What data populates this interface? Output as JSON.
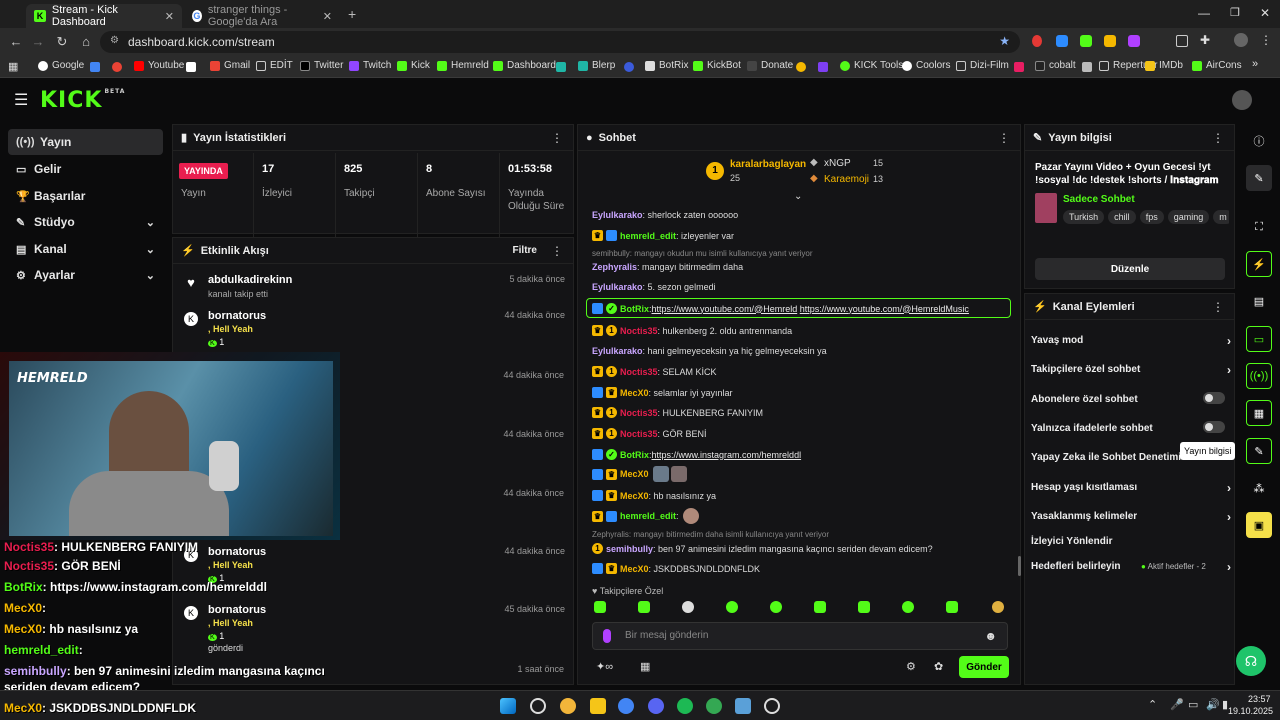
{
  "browser": {
    "tabs": [
      {
        "title": "Stream - Kick Dashboard",
        "active": true
      },
      {
        "title": "stranger things - Google'da Ara",
        "active": false
      }
    ],
    "url": "dashboard.kick.com/stream",
    "bookmarks": [
      "Google",
      "Youtube",
      "Gmail",
      "EDİT",
      "Twitter",
      "Twitch",
      "Kick",
      "Hemreld",
      "Dashboard",
      "Blerp",
      "BotRix",
      "KickBot",
      "Donate",
      "KICK Tools",
      "Coolors",
      "Dizi-Film",
      "cobalt",
      "Repertuar",
      "IMDb",
      "AirCons"
    ]
  },
  "kick": {
    "logo": "KICK",
    "logo_badge": "BETA"
  },
  "leftnav": {
    "items": [
      {
        "label": "Yayın",
        "icon": "broadcast-icon"
      },
      {
        "label": "Gelir",
        "icon": "money-icon"
      },
      {
        "label": "Başarılar",
        "icon": "trophy-icon"
      },
      {
        "label": "Stüdyo",
        "icon": "studio-icon"
      },
      {
        "label": "Kanal",
        "icon": "channel-icon"
      },
      {
        "label": "Ayarlar",
        "icon": "settings-icon"
      }
    ]
  },
  "stats": {
    "title": "Yayın İstatistikleri",
    "live_badge": "YAYINDA",
    "live_label": "Yayın",
    "viewers": "17",
    "viewers_label": "İzleyici",
    "followers": "825",
    "followers_label": "Takipçi",
    "subs": "8",
    "subs_label": "Abone Sayısı",
    "duration": "01:53:58",
    "duration_label": "Yayında Olduğu Süre"
  },
  "feed": {
    "title": "Etkinlik Akışı",
    "filter": "Filtre",
    "items": [
      {
        "name": "abdulkadirekinn",
        "sub": "kanalı takip etti",
        "time": "5 dakika önce"
      },
      {
        "name": "bornatorus",
        "sub": ", Hell Yeah",
        "count": "1",
        "time": "44 dakika önce"
      },
      {
        "time": "44 dakika önce"
      },
      {
        "time": "44 dakika önce"
      },
      {
        "time": "44 dakika önce"
      },
      {
        "name": "bornatorus",
        "sub": ", Hell Yeah",
        "count": "1",
        "time": "44 dakika önce"
      },
      {
        "name": "bornatorus",
        "sub": ", Hell Yeah",
        "count": "1",
        "extra": "gönderdi",
        "time": "45 dakika önce"
      },
      {
        "time": "1 saat önce"
      }
    ]
  },
  "chat": {
    "title": "Sohbet",
    "top1_name": "karalarbaglayan",
    "top1_count": "25",
    "top2_name": "xNGP",
    "top2_count": "15",
    "top3_name": "Karaemoji",
    "top3_count": "13",
    "lines": [
      {
        "user": "Eylulkarako",
        "msg": ": sherlock zaten oooooo"
      },
      {
        "user": "hemreld_edit",
        "msg": ": izleyenler var"
      },
      {
        "reply": "semihbully: mangayı okudun mu isimli kullanıcıya yanıt veriyor"
      },
      {
        "user": "Zephyralis",
        "msg": ": mangayı bitirmedim daha"
      },
      {
        "user": "Eylulkarako",
        "msg": ": 5. sezon gelmedi"
      },
      {
        "user": "BotRix",
        "msg": ": ",
        "link1": "https://www.youtube.com/@Hemreld",
        "link2": "https://www.youtube.com/@HemreldMusic"
      },
      {
        "user": "Noctis35",
        "msg": ": hulkenberg 2. oldu antrenmanda"
      },
      {
        "user": "Eylulkarako",
        "msg": ": hani gelmeyeceksin ya hiç gelmeyeceksin ya"
      },
      {
        "user": "Noctis35",
        "msg": ": SELAM KİCK"
      },
      {
        "user": "MecX0",
        "msg": ": selamlar iyi yayınlar"
      },
      {
        "user": "Noctis35",
        "msg": ": HULKENBERG FANIYIM"
      },
      {
        "user": "Noctis35",
        "msg": ": GÖR BENİ"
      },
      {
        "user": "BotRix",
        "msg": ": ",
        "link1": "https://www.instagram.com/hemrelddl"
      },
      {
        "user": "MecX0",
        "msg": ":"
      },
      {
        "user": "MecX0",
        "msg": ": hb nasılsınız ya"
      },
      {
        "user": "hemreld_edit",
        "msg": ":"
      },
      {
        "reply": "Zephyralis: mangayı bitirmedim daha isimli kullanıcıya yanıt veriyor"
      },
      {
        "user": "semihbully",
        "msg": ": ben 97 animesini izledim mangasına kaçıncı seriden devam edicem?"
      },
      {
        "user": "MecX0",
        "msg": ": JSKDDBSJNDLDDNFLDK"
      }
    ],
    "followers_only": "Takipçilere Özel",
    "input_placeholder": "Bir mesaj gönderin",
    "send": "Gönder"
  },
  "info": {
    "title": "Yayın bilgisi",
    "stream_title": "Pazar Yayını Video + Oyun Gecesi !yt !sosyal !dc !destek !shorts / 𝐈𝐧𝐬𝐭𝐚𝐠𝐫𝐚𝐦 :...",
    "category": "Sadece Sohbet",
    "tags": [
      "Turkish",
      "chill",
      "fps",
      "gaming",
      "m"
    ],
    "edit": "Düzenle"
  },
  "actions": {
    "title": "Kanal Eylemleri",
    "items": [
      {
        "label": "Yavaş mod",
        "type": "arrow"
      },
      {
        "label": "Takipçilere özel sohbet",
        "type": "arrow"
      },
      {
        "label": "Abonelere özel sohbet",
        "type": "toggle"
      },
      {
        "label": "Yalnızca ifadelerle sohbet",
        "type": "toggle"
      },
      {
        "label": "Yapay Zeka ile Sohbet Denetimi",
        "type": "toggle"
      },
      {
        "label": "Hesap yaşı kısıtlaması",
        "type": "arrow"
      },
      {
        "label": "Yasaklanmış kelimeler",
        "type": "arrow"
      },
      {
        "label": "İzleyici Yönlendir",
        "type": "none"
      },
      {
        "label": "Hedefleri belirleyin",
        "type": "arrow",
        "extra": "Aktif hedefler - 2"
      }
    ],
    "tooltip": "Yayın bilgisi"
  },
  "overlay": {
    "lines": [
      {
        "user": "Noctis35",
        "msg": ": HULKENBERG FANIYIM"
      },
      {
        "user": "Noctis35",
        "msg": ": GÖR BENİ"
      },
      {
        "user": "BotRix",
        "msg": ": https://www.instagram.com/hemrelddl"
      },
      {
        "user": "MecX0",
        "msg": ":"
      },
      {
        "user": "MecX0",
        "msg": ": hb nasılsınız ya"
      },
      {
        "user": "hemreld_edit",
        "msg": ":"
      },
      {
        "user": "semihbully",
        "msg": ": ben 97 animesini izledim mangasına kaçıncı"
      },
      {
        "user": "",
        "msg": "seriden devam edicem?"
      },
      {
        "user": "MecX0",
        "msg": ": JSKDDBSJNDLDDNFLDK"
      }
    ],
    "cam_label": "HEMRELD"
  },
  "taskbar": {
    "time": "23:57",
    "date": "19.10.2025"
  },
  "colors": {
    "accent": "#53fc18",
    "live": "#e91e4f",
    "noctis": "#e91e4f",
    "botrix": "#53fc18",
    "mecx0": "#f5b800",
    "eylul": "#c9a6ff",
    "hemreld": "#53fc18",
    "zeph": "#c9a6ff",
    "semih": "#c9a6ff"
  }
}
